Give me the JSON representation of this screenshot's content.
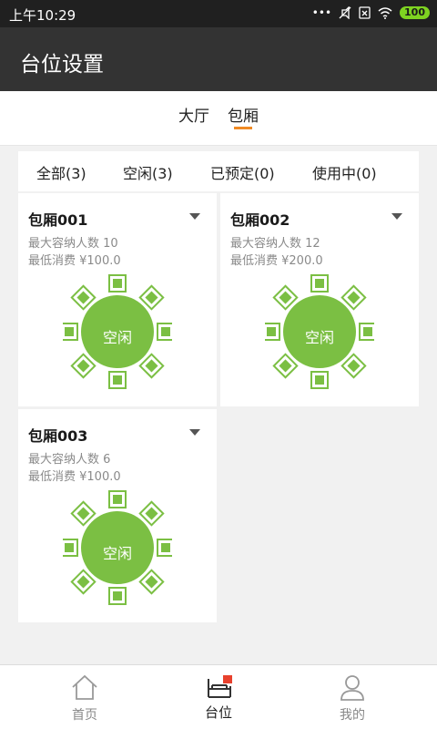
{
  "status_bar": {
    "time": "上午10:29",
    "icons": [
      "dots-icon",
      "mute-icon",
      "sim-icon",
      "wifi-icon",
      "battery-icon"
    ],
    "battery": "100"
  },
  "header": {
    "title": "台位设置"
  },
  "area_tabs": [
    {
      "label": "大厅",
      "active": false
    },
    {
      "label": "包厢",
      "active": true
    }
  ],
  "filters": [
    "全部(3)",
    "空闲(3)",
    "已预定(0)",
    "使用中(0)"
  ],
  "tables": [
    {
      "name": "包厢001",
      "capacity": "最大容纳人数 10",
      "min_spend": "最低消费 ¥100.0",
      "status": "空闲"
    },
    {
      "name": "包厢002",
      "capacity": "最大容纳人数 12",
      "min_spend": "最低消费 ¥200.0",
      "status": "空闲"
    },
    {
      "name": "包厢003",
      "capacity": "最大容纳人数 6",
      "min_spend": "最低消费 ¥100.0",
      "status": "空闲"
    }
  ],
  "colors": {
    "accent": "#f08a24",
    "table_green": "#7bbf43",
    "header_bg": "#333333"
  },
  "bottom_nav": [
    {
      "label": "首页",
      "icon": "home-icon",
      "active": false
    },
    {
      "label": "台位",
      "icon": "table-seat-icon",
      "active": true
    },
    {
      "label": "我的",
      "icon": "person-icon",
      "active": false
    }
  ]
}
